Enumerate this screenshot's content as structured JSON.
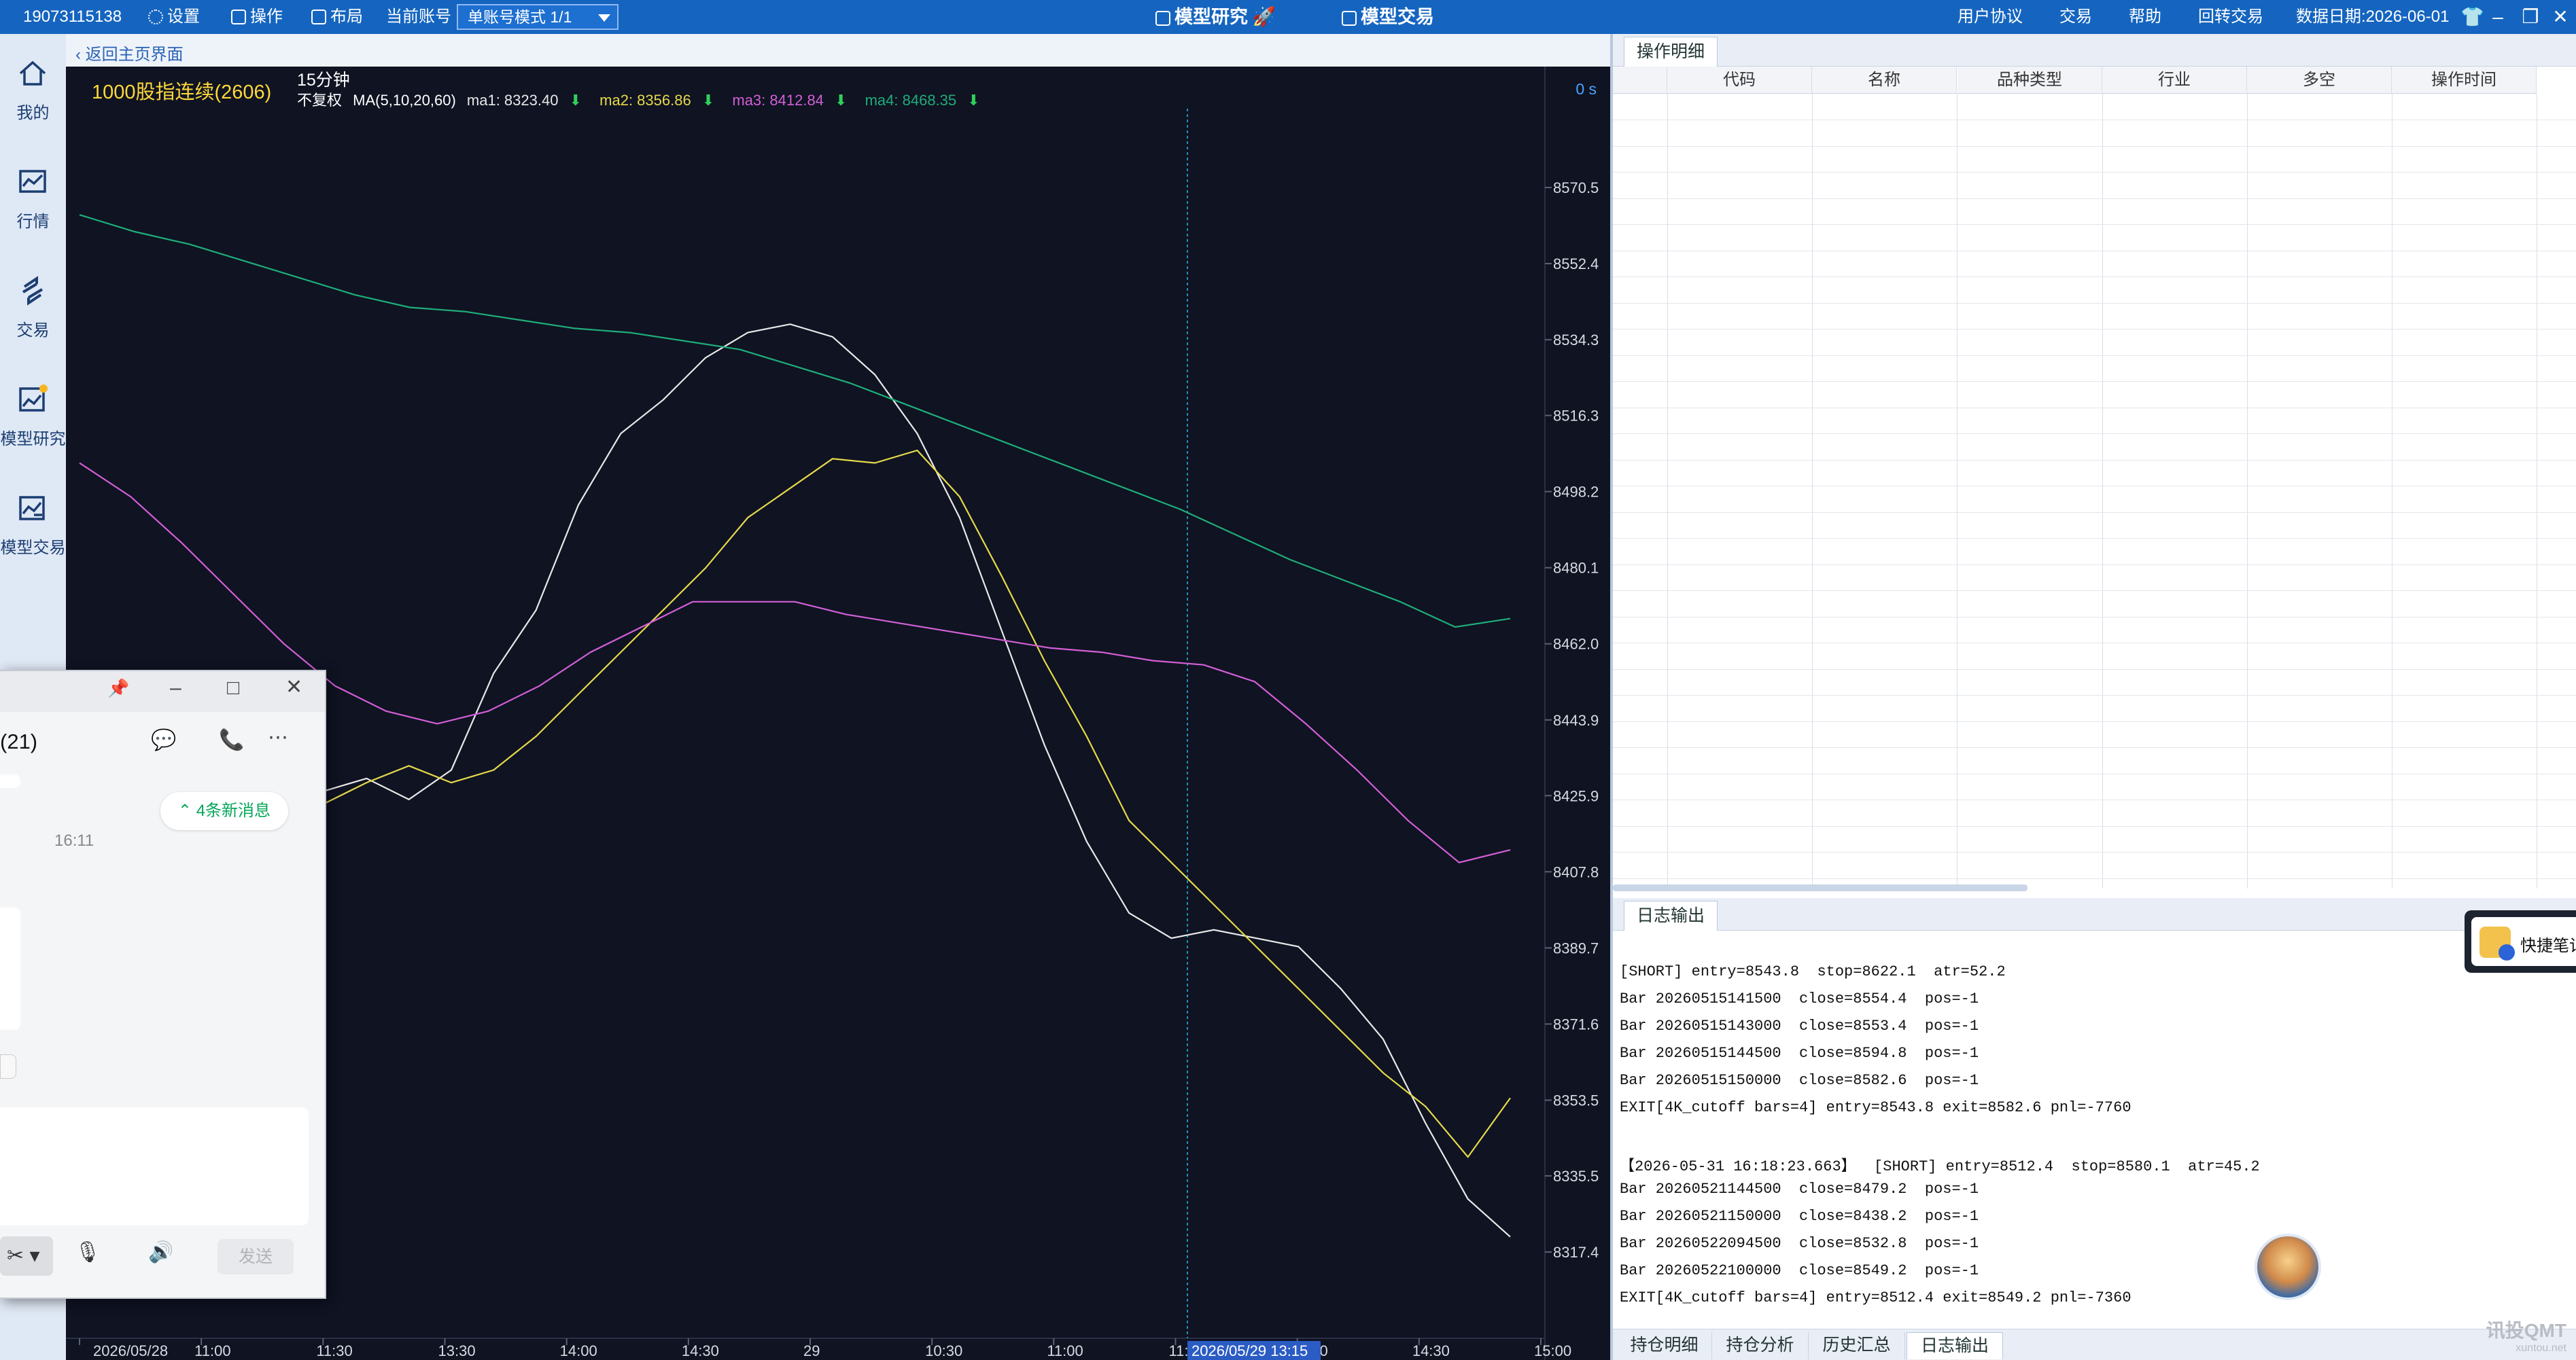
{
  "topbar": {
    "account_id": "19073115138",
    "settings_label": "设置",
    "operate_label": "操作",
    "layout_label": "布局",
    "current_account_label": "当前账号",
    "mode_select_value": "单账号模式 1/1",
    "center_tabs": [
      "模型研究",
      "模型交易"
    ],
    "user_agreement": "用户协议",
    "trade": "交易",
    "help": "帮助",
    "switch_trade": "回转交易",
    "data_date": "数据日期:2026-06-01"
  },
  "sidebar": {
    "items": [
      {
        "label": "我的",
        "icon": "home-icon"
      },
      {
        "label": "行情",
        "icon": "market-icon"
      },
      {
        "label": "交易",
        "icon": "trade-icon"
      },
      {
        "label": "模型研究",
        "icon": "model-research-icon"
      },
      {
        "label": "模型交易",
        "icon": "model-trade-icon"
      }
    ]
  },
  "chart_header": {
    "back_label": "返回主页界面"
  },
  "chart": {
    "title": "1000股指连续(2606)",
    "period": "15分钟",
    "adjust": "不复权",
    "ma_label": "MA(5,10,20,60)",
    "ma1_text": "ma1: 8323.40",
    "ma2_text": "ma2: 8356.86",
    "ma3_text": "ma3: 8412.84",
    "ma4_text": "ma4: 8468.35",
    "os_label": "0 s",
    "crosshair_label": "2026/05/29 13:15",
    "colors": {
      "bg": "#0f1322",
      "ma1": "#e8e8e8",
      "ma2": "#e6d94a",
      "ma3": "#d35fd6",
      "ma4": "#1fae7a",
      "crosshair": "#1f8fb3",
      "title": "#ffd83a",
      "down_arrow": "#2fd05a"
    }
  },
  "chart_data": {
    "type": "line",
    "title": "1000股指连续(2606)",
    "x_tick_labels": [
      "2026/05/28",
      "11:00",
      "11:30",
      "13:30",
      "14:00",
      "14:30",
      "29",
      "10:30",
      "11:00",
      "11:30",
      "14:00",
      "14:30",
      "15:00"
    ],
    "y_tick_labels": [
      "8570.5",
      "8552.4",
      "8534.3",
      "8516.3",
      "8498.2",
      "8480.1",
      "8462.0",
      "8443.9",
      "8425.9",
      "8407.8",
      "8389.7",
      "8371.6",
      "8353.5",
      "8335.5",
      "8317.4"
    ],
    "ylim": [
      8317.4,
      8570.5
    ],
    "grid": false,
    "series": [
      {
        "name": "ma1",
        "values": [
          8427,
          8430,
          8425,
          8432,
          8455,
          8470,
          8495,
          8512,
          8520,
          8530,
          8536,
          8538,
          8535,
          8526,
          8512,
          8492,
          8465,
          8438,
          8415,
          8398,
          8392,
          8394,
          8392,
          8390,
          8380,
          8368,
          8348,
          8330,
          8321
        ]
      },
      {
        "name": "ma2",
        "values": [
          8424,
          8429,
          8433,
          8429,
          8432,
          8440,
          8450,
          8460,
          8470,
          8480,
          8492,
          8499,
          8506,
          8505,
          8508,
          8497,
          8478,
          8458,
          8440,
          8420,
          8410,
          8400,
          8390,
          8380,
          8370,
          8360,
          8352,
          8340,
          8354
        ]
      },
      {
        "name": "ma3",
        "values": [
          8505,
          8497,
          8486,
          8474,
          8462,
          8452,
          8446,
          8443,
          8446,
          8452,
          8460,
          8466,
          8472,
          8472,
          8472,
          8469,
          8467,
          8465,
          8463,
          8461,
          8460,
          8458,
          8457,
          8453,
          8443,
          8432,
          8420,
          8410,
          8413
        ]
      },
      {
        "name": "ma4",
        "values": [
          8564,
          8560,
          8557,
          8553,
          8549,
          8545,
          8542,
          8541,
          8539,
          8537,
          8536,
          8534,
          8532,
          8528,
          8524,
          8519,
          8514,
          8509,
          8504,
          8499,
          8494,
          8488,
          8482,
          8477,
          8472,
          8466,
          8468
        ]
      }
    ]
  },
  "ops_panel": {
    "tab_label": "操作明细",
    "columns": [
      "代码",
      "名称",
      "品种类型",
      "行业",
      "多空",
      "操作时间"
    ]
  },
  "log_panel": {
    "tab_label": "日志输出",
    "lines": [
      "[SHORT] entry=8543.8  stop=8622.1  atr=52.2",
      "Bar 20260515141500  close=8554.4  pos=-1",
      "Bar 20260515143000  close=8553.4  pos=-1",
      "Bar 20260515144500  close=8594.8  pos=-1",
      "Bar 20260515150000  close=8582.6  pos=-1",
      "EXIT[4K_cutoff bars=4] entry=8543.8 exit=8582.6 pnl=-7760",
      "",
      "【2026-05-31 16:18:23.663】  [SHORT] entry=8512.4  stop=8580.1  atr=45.2",
      "Bar 20260521144500  close=8479.2  pos=-1",
      "Bar 20260521150000  close=8438.2  pos=-1",
      "Bar 20260522094500  close=8532.8  pos=-1",
      "Bar 20260522100000  close=8549.2  pos=-1",
      "EXIT[4K_cutoff bars=4] entry=8512.4 exit=8549.2 pnl=-7360"
    ],
    "bottom_tabs": [
      "持仓明细",
      "持仓分析",
      "历史汇总",
      "日志输出"
    ]
  },
  "quick_note": {
    "label": "快捷笔记"
  },
  "watermark": {
    "title": "讯投QMT",
    "sub": "xuntou.net"
  },
  "chat_window": {
    "title": "(21)",
    "new_messages": "4条新消息",
    "time": "16:11",
    "send_label": "发送"
  }
}
